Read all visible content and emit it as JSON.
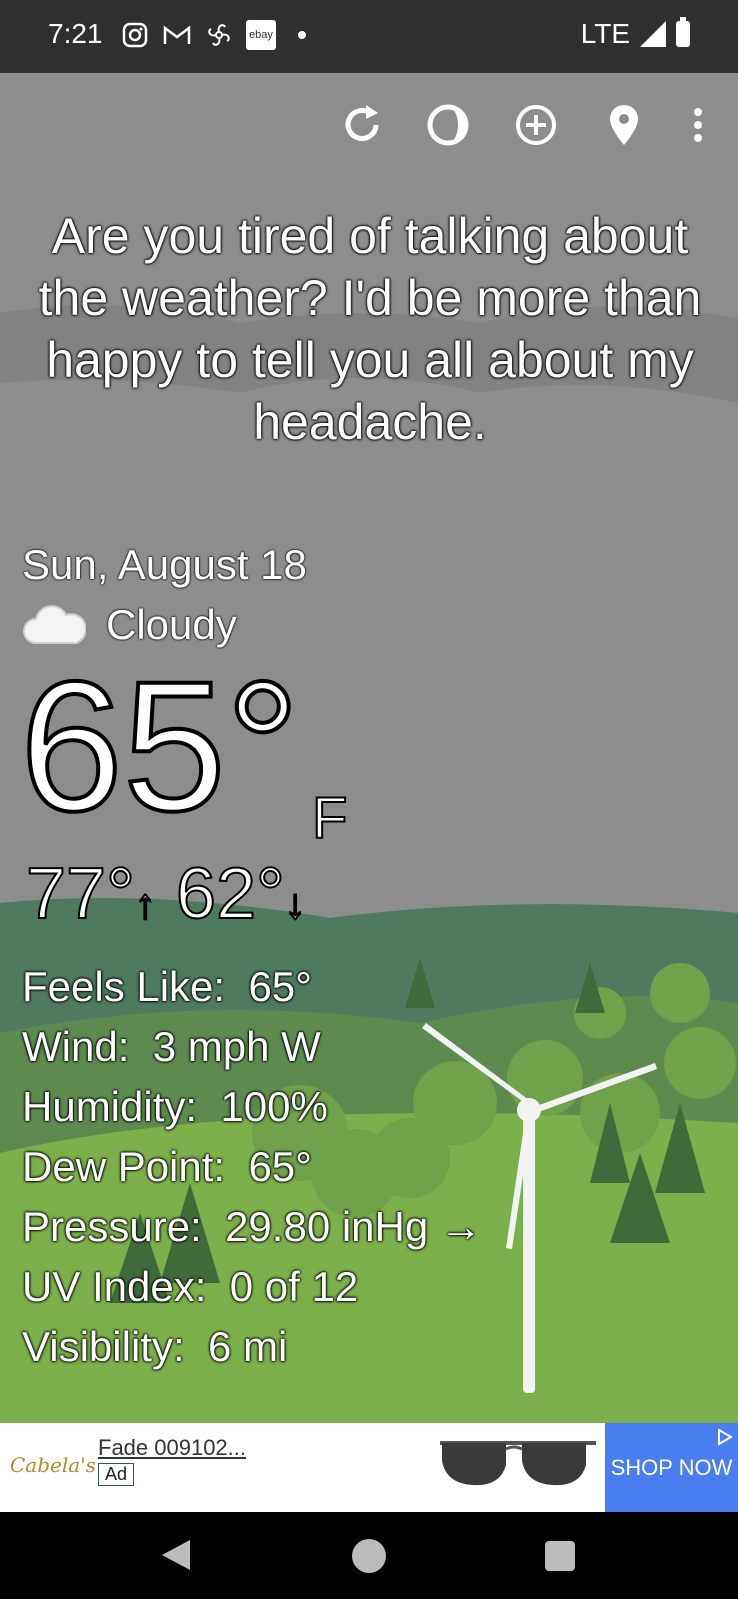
{
  "status_bar": {
    "time": "7:21",
    "network": "LTE",
    "icons": [
      "instagram-icon",
      "gmail-icon",
      "fan-icon",
      "ebay-icon",
      "notification-dot-icon"
    ],
    "ebay_label": "ebay"
  },
  "toolbar": {
    "icons": [
      "refresh-icon",
      "theme-icon",
      "add-location-icon",
      "location-pin-icon",
      "more-options-icon"
    ]
  },
  "quote": "Are you tired of talking about the weather? I'd be more than happy to tell you all about my headache.",
  "weather": {
    "date": "Sun, August 18",
    "condition": "Cloudy",
    "condition_icon": "cloud-icon",
    "temperature": "65°",
    "unit": "F",
    "high": "77°",
    "low": "62°",
    "high_arrow": "↑",
    "low_arrow": "↓",
    "details": [
      {
        "label": "Feels Like:",
        "value": "65°"
      },
      {
        "label": "Wind:",
        "value": "3 mph W"
      },
      {
        "label": "Humidity:",
        "value": "100%"
      },
      {
        "label": "Dew Point:",
        "value": "65°"
      },
      {
        "label": "Pressure:",
        "value": "29.80 inHg →"
      },
      {
        "label": "UV Index:",
        "value": "0 of 12"
      },
      {
        "label": "Visibility:",
        "value": "6 mi"
      }
    ]
  },
  "ad": {
    "brand": "Cabela's",
    "title": "Fade 009102...",
    "tag": "Ad",
    "cta": "SHOP NOW"
  },
  "colors": {
    "sky": "#8d8d8d",
    "hill_dark": "#4e7a5f",
    "grass": "#7bb04a",
    "ad_button": "#4a7df0"
  }
}
